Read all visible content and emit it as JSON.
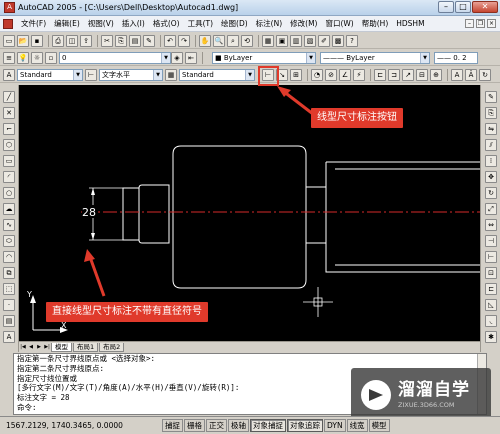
{
  "window": {
    "title": "AutoCAD 2005 - [C:\\Users\\Dell\\Desktop\\Autocad1.dwg]",
    "app_icon": "autocad-app-icon"
  },
  "menu": {
    "items": [
      "文件(F)",
      "编辑(E)",
      "视图(V)",
      "插入(I)",
      "格式(O)",
      "工具(T)",
      "绘图(D)",
      "标注(N)",
      "修改(M)",
      "窗口(W)",
      "帮助(H)",
      "HDSHM"
    ]
  },
  "toolbar": {
    "layer_value": "0",
    "color_value": "ByLayer",
    "linetype_value": "ByLayer",
    "lineweight_value": "0. 2",
    "text_style_value": "Standard",
    "dim_style_label": "文字水平",
    "dim_style_value": "Standard"
  },
  "drawing": {
    "dimension_text": "28",
    "ucs_y": "Y",
    "ucs_x": "X"
  },
  "layout_tabs": [
    "模型",
    "布局1",
    "布局2"
  ],
  "callouts": {
    "linear_dim_button": "线型尺寸标注按钮",
    "no_diameter_symbol": "直接线型尺寸标注不带有直径符号"
  },
  "command_lines": [
    "指定第一条尺寸界线原点或 <选择对象>:",
    "指定第二条尺寸界线原点:",
    "指定尺寸线位置或",
    "[多行文字(M)/文字(T)/角度(A)/水平(H)/垂直(V)/旋转(R)]:",
    "标注文字 = 28",
    "命令:"
  ],
  "status": {
    "coordinates": "1567.2129, 1740.3465, 0.0000",
    "buttons": [
      "捕捉",
      "栅格",
      "正交",
      "极轴",
      "对象捕捉",
      "对象追踪",
      "DYN",
      "线宽",
      "模型"
    ]
  },
  "watermark": {
    "name": "溜溜自学",
    "url": "ZIXUE.3D66.COM"
  },
  "colors": {
    "canvas": "#000000",
    "callout": "#e03a2b",
    "centerline": "#d42a2a",
    "dimension": "#ffffff",
    "highlight_box": "#e03a2b"
  }
}
